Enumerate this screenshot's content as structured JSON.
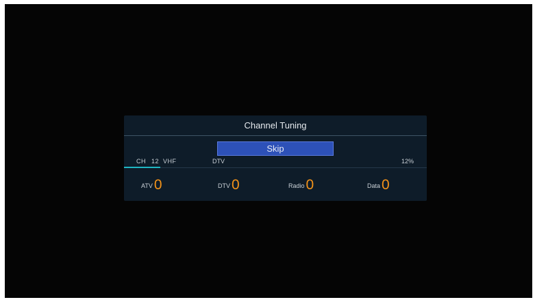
{
  "dialog": {
    "title": "Channel Tuning",
    "skip_label": "Skip"
  },
  "status": {
    "channel_prefix": "CH",
    "channel_number": "12",
    "band": "VHF",
    "mode": "DTV",
    "percent_text": "12%",
    "progress": 0.12
  },
  "counts": [
    {
      "label": "ATV",
      "value": "0"
    },
    {
      "label": "DTV",
      "value": "0"
    },
    {
      "label": "Radio",
      "value": "0"
    },
    {
      "label": "Data",
      "value": "0"
    }
  ],
  "colors": {
    "accent_orange": "#f29219",
    "button_blue": "#2d51b8",
    "progress_cyan": "#1fb7c4",
    "panel_bg": "#0e1c29"
  }
}
